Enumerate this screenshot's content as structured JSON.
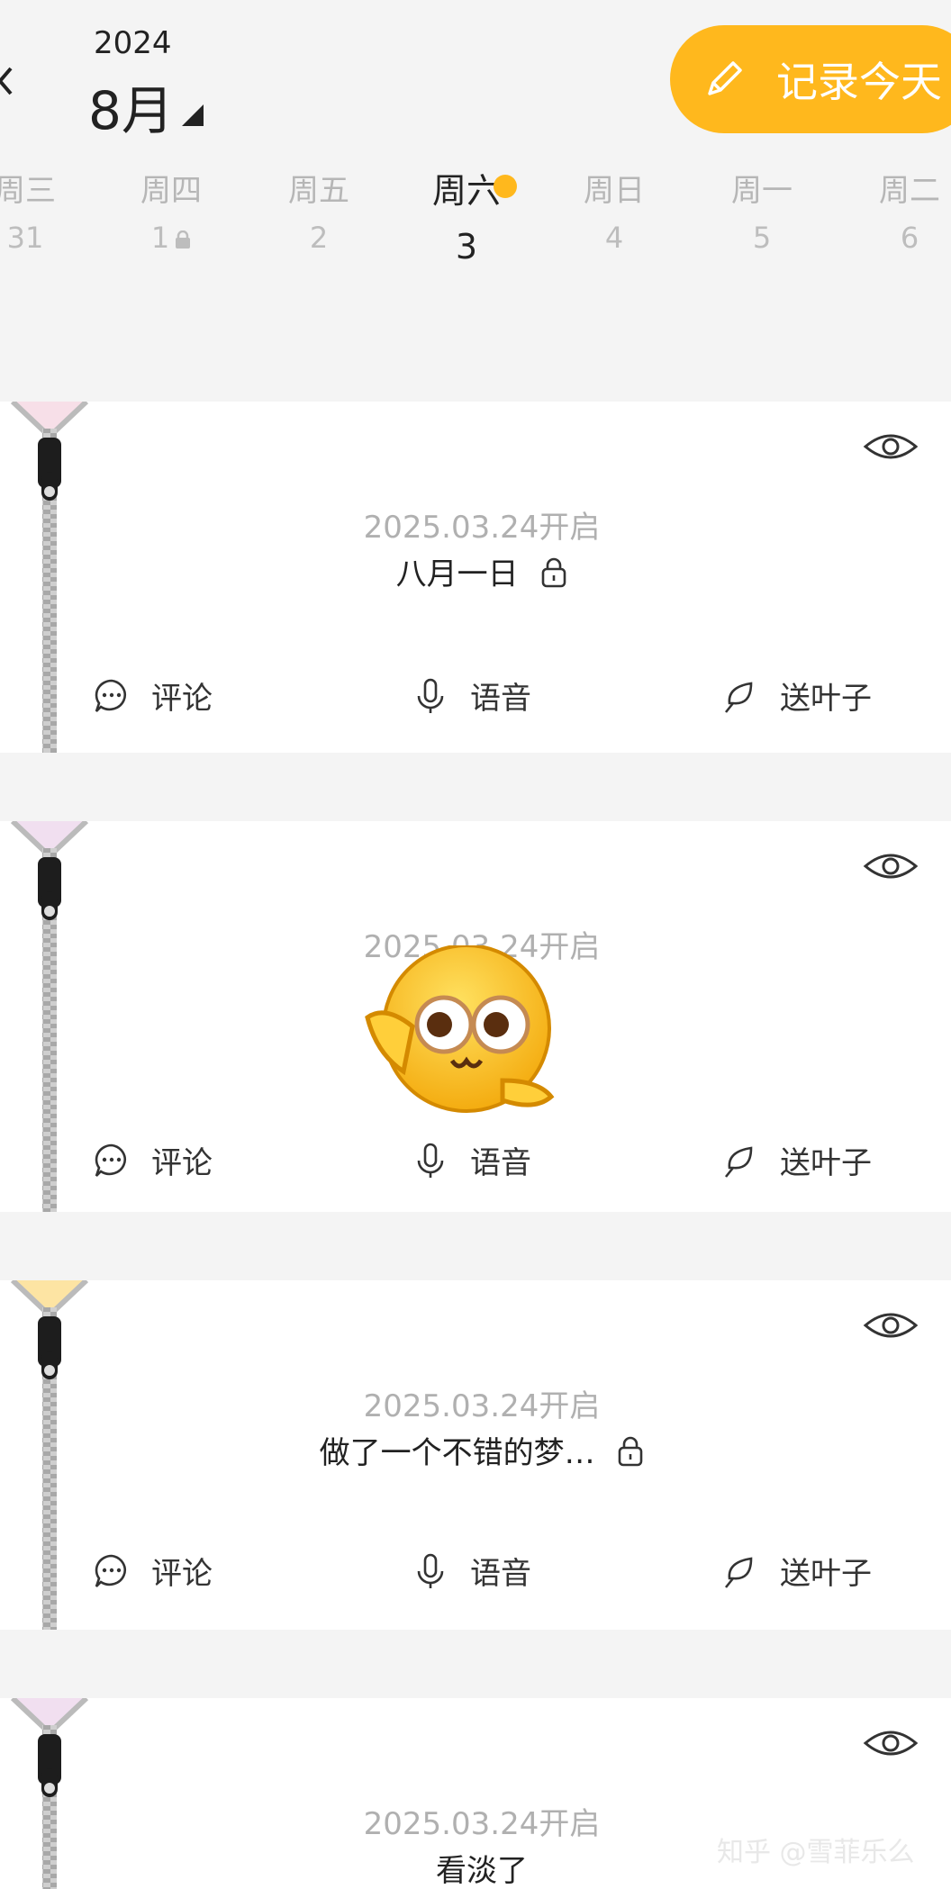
{
  "header": {
    "year": "2024",
    "month": "8月",
    "record_button": "记录今天"
  },
  "week": [
    {
      "name": "周三",
      "num": "31",
      "locked": false,
      "active": false
    },
    {
      "name": "周四",
      "num": "1",
      "locked": true,
      "active": false
    },
    {
      "name": "周五",
      "num": "2",
      "locked": false,
      "active": false
    },
    {
      "name": "周六",
      "num": "3",
      "locked": false,
      "active": true
    },
    {
      "name": "周日",
      "num": "4",
      "locked": false,
      "active": false
    },
    {
      "name": "周一",
      "num": "5",
      "locked": false,
      "active": false
    },
    {
      "name": "周二",
      "num": "6",
      "locked": false,
      "active": false
    }
  ],
  "entries": [
    {
      "open_date": "2025.03.24开启",
      "title": "八月一日",
      "locked": true,
      "zipper_color": "#f7dfe8"
    },
    {
      "open_date": "2025.03.24开启",
      "title": "",
      "locked": true,
      "zipper_color": "#f1dff0"
    },
    {
      "open_date": "2025.03.24开启",
      "title": "做了一个不错的梦…",
      "locked": true,
      "zipper_color": "#fde4a3"
    },
    {
      "open_date": "2025.03.24开启",
      "title": "看淡了",
      "locked": false,
      "zipper_color": "#f1dff0"
    }
  ],
  "actions": {
    "comment": "评论",
    "voice": "语音",
    "leaf": "送叶子"
  },
  "watermark": "知乎 @雪菲乐么",
  "colors": {
    "accent": "#ffb81d",
    "background": "#f4f4f4",
    "card": "#ffffff"
  }
}
